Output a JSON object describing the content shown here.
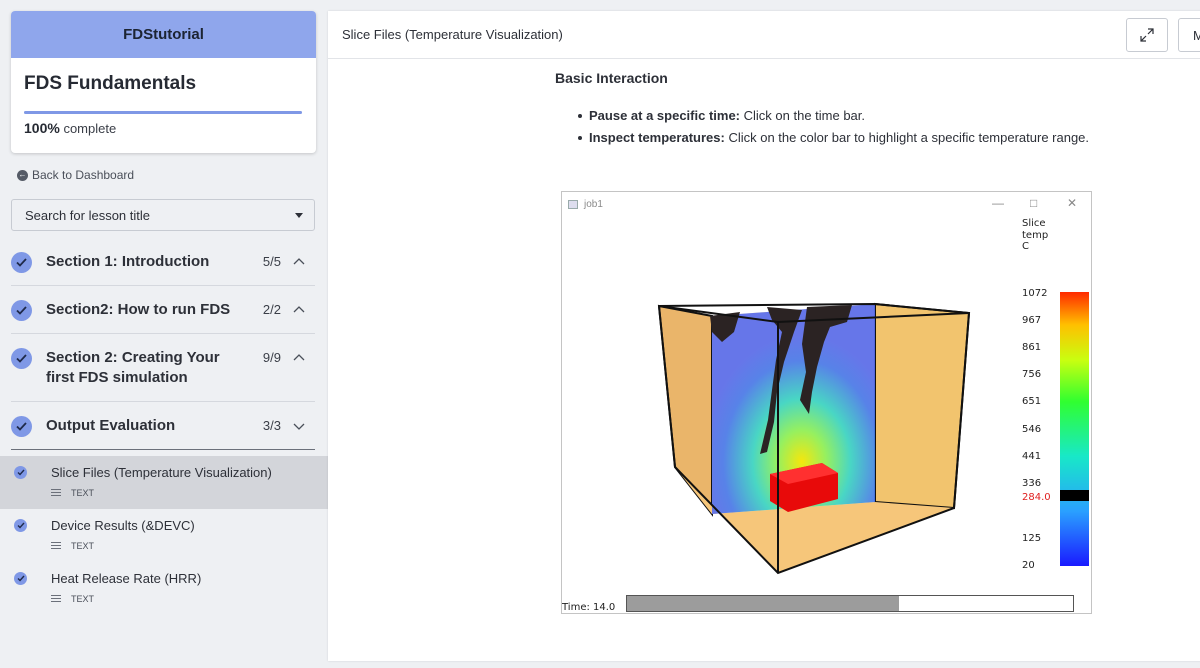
{
  "sidebar": {
    "brand": "FDStutorial",
    "course_title": "FDS Fundamentals",
    "progress_fraction": 1.0,
    "progress_percent": "100%",
    "progress_suffix": "complete",
    "back_link": "Back to Dashboard",
    "search_placeholder": "Search for lesson title",
    "sections": [
      {
        "title": "Section 1: Introduction",
        "count": "5/5",
        "expanded": false
      },
      {
        "title": "Section2: How to run FDS",
        "count": "2/2",
        "expanded": false
      },
      {
        "title": "Section 2: Creating Your first FDS simulation",
        "count": "9/9",
        "expanded": false
      },
      {
        "title": "Output Evaluation",
        "count": "3/3",
        "expanded": true
      }
    ],
    "lessons": [
      {
        "title": "Slice Files (Temperature Visualization)",
        "type": "TEXT",
        "active": true
      },
      {
        "title": "Device Results (&DEVC)",
        "type": "TEXT",
        "active": false
      },
      {
        "title": "Heat Release Rate (HRR)",
        "type": "TEXT",
        "active": false
      }
    ]
  },
  "main": {
    "header_title": "Slice Files (Temperature Visualization)",
    "menu_button_label": "M",
    "expand_icon": "expand-icon",
    "content": {
      "heading": "Basic Interaction",
      "items": [
        {
          "bold": "Pause at a specific time:",
          "text": " Click on the time bar."
        },
        {
          "bold": "Inspect temperatures:",
          "text": " Click on the color bar to highlight a specific temperature range."
        }
      ]
    },
    "figure": {
      "window_title": "job1",
      "colorbar_label": [
        "Slice",
        "temp",
        "C"
      ],
      "ticks": [
        "1072",
        "967",
        "861",
        "756",
        "651",
        "546",
        "441",
        "336",
        "284.0",
        "125",
        "20"
      ],
      "highlight_tick": "284.0",
      "time_label": "Time: 14.0",
      "time_fraction": 0.61
    }
  },
  "colors": {
    "accent": "#7f98e6",
    "brand_bg": "#8fa6ec",
    "highlight": "#e02020"
  }
}
